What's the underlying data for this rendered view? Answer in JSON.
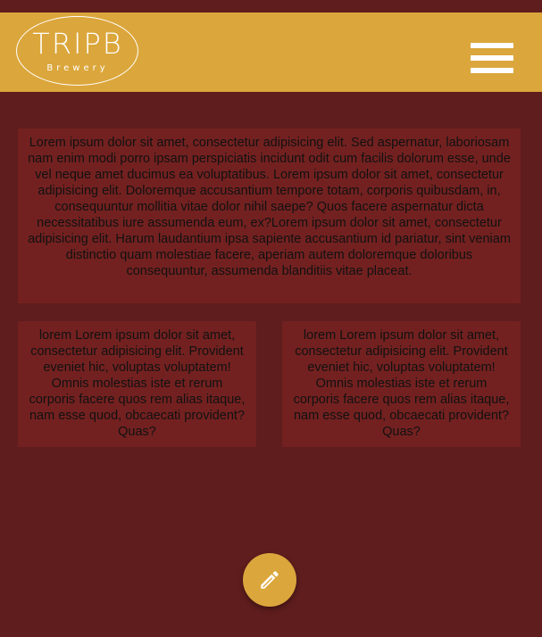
{
  "header": {
    "logo_text": "TRIPB",
    "logo_subtext": "Brewery",
    "background_color": "#dba63b"
  },
  "menu": {
    "icon": "hamburger-menu-icon"
  },
  "content": {
    "main_text": "Lorem ipsum dolor sit amet, consectetur adipisicing elit. Sed aspernatur, laboriosam nam enim modi porro ipsam perspiciatis incidunt odit cum facilis dolorum esse, unde vel neque amet ducimus ea voluptatibus. Lorem ipsum dolor sit amet, consectetur adipisicing elit. Doloremque accusantium tempore totam, corporis quibusdam, in, consequuntur mollitia vitae dolor nihil saepe? Quos facere aspernatur dicta necessitatibus iure assumenda eum, ex?Lorem ipsum dolor sit amet, consectetur adipisicing elit. Harum laudantium ipsa sapiente accusantium id pariatur, sint veniam distinctio quam molestiae facere, aperiam autem doloremque doloribus consequuntur, assumenda blanditiis vitae placeat.",
    "left_text": "lorem Lorem ipsum dolor sit amet, consectetur adipisicing elit. Provident eveniet hic, voluptas voluptatem! Omnis molestias iste et rerum corporis facere quos rem alias itaque, nam esse quod, obcaecati provident? Quas?",
    "right_text": "lorem Lorem ipsum dolor sit amet, consectetur adipisicing elit. Provident eveniet hic, voluptas voluptatem! Omnis molestias iste et rerum corporis facere quos rem alias itaque, nam esse quod, obcaecati provident? Quas?"
  },
  "fab": {
    "icon": "pencil-icon"
  },
  "colors": {
    "page_background": "#5f1d1d",
    "card_background": "#732120",
    "accent": "#dba63b"
  }
}
